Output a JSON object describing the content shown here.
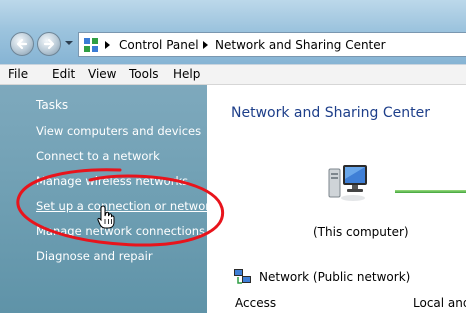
{
  "address_bar": {
    "breadcrumbs": [
      "Control Panel",
      "Network and Sharing Center"
    ],
    "icons": {
      "back": "back-arrow-icon",
      "forward": "forward-arrow-icon",
      "control_panel": "control-panel-icon"
    }
  },
  "menu": [
    "File",
    "Edit",
    "View",
    "Tools",
    "Help"
  ],
  "tasks": {
    "heading": "Tasks",
    "items": [
      "View computers and devices",
      "Connect to a network",
      "Manage wireless networks",
      "Set up a connection or network",
      "Manage network connections",
      "Diagnose and repair"
    ],
    "hovered_index": 3
  },
  "main": {
    "title": "Network and Sharing Center",
    "computer_label": "(This computer)",
    "network_label": "Network (Public network)",
    "access_label": "Access",
    "access_value": "Local and I"
  },
  "colors": {
    "task_pane": "#6f9fb3",
    "title": "#1e3f8a",
    "annotation": "#e8141c",
    "connection_line": "#4cb244"
  },
  "annotation": "red-hand-drawn-circle"
}
